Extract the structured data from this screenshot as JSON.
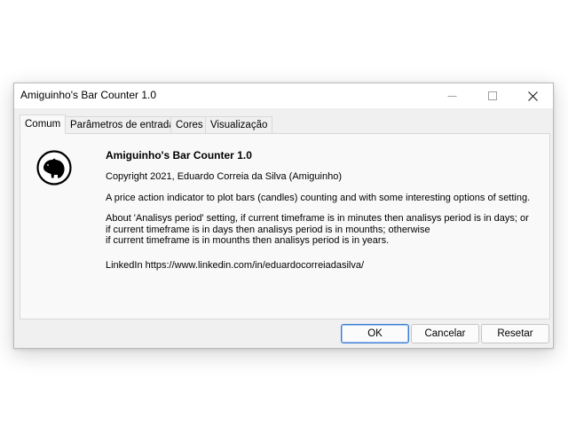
{
  "window": {
    "title": "Amiguinho's Bar Counter 1.0"
  },
  "tabs": [
    {
      "label": "Comum"
    },
    {
      "label": "Parâmetros de entrada"
    },
    {
      "label": "Cores"
    },
    {
      "label": "Visualização"
    }
  ],
  "about": {
    "heading": "Amiguinho's Bar Counter 1.0",
    "copyright": "Copyright 2021, Eduardo Correia da Silva (Amiguinho)",
    "description": "A price action indicator to plot bars (candles) counting and with some interesting options of setting.",
    "period_line1": "About 'Analisys period' setting, if current timeframe is in minutes then analisys period is in days; or",
    "period_line2": "if current timeframe is in days then analisys period is in mounths; otherwise",
    "period_line3": "if current timeframe is in mounths then analisys period is in years.",
    "linkedin": "LinkedIn https://www.linkedin.com/in/eduardocorreiadasilva/"
  },
  "buttons": {
    "ok": "OK",
    "cancel": "Cancelar",
    "reset": "Resetar"
  },
  "icons": {
    "logo": "capybara-logo-icon",
    "minimize": "minimize-icon",
    "maximize": "maximize-icon",
    "close": "close-icon"
  },
  "colors": {
    "accent": "#3c7dd4"
  }
}
